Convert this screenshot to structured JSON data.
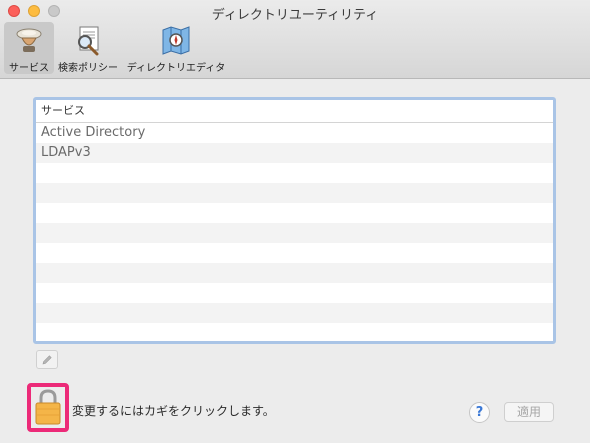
{
  "window": {
    "title": "ディレクトリユーティリティ"
  },
  "toolbar": {
    "items": [
      {
        "label": "サービス",
        "icon": "services-icon",
        "selected": true
      },
      {
        "label": "検索ポリシー",
        "icon": "search-policy-icon",
        "selected": false
      },
      {
        "label": "ディレクトリエディタ",
        "icon": "directory-editor-icon",
        "selected": false
      }
    ]
  },
  "services_table": {
    "header": "サービス",
    "rows": [
      "Active Directory",
      "LDAPv3",
      "",
      "",
      "",
      "",
      "",
      "",
      "",
      "",
      ""
    ]
  },
  "footer": {
    "lock_text": "変更するにはカギをクリックします。",
    "help_label": "?",
    "apply_label": "適用"
  },
  "colors": {
    "lock_highlight": "#ec2a78",
    "table_focus_ring": "#a9c4e6",
    "help_accent": "#3a78d6"
  }
}
